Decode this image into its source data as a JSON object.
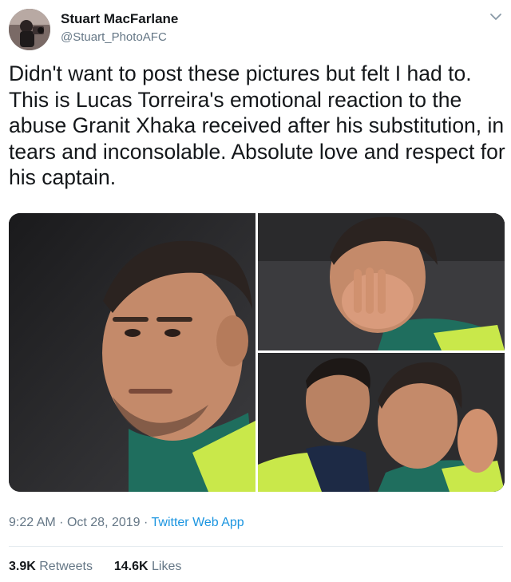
{
  "author": {
    "display_name": "Stuart MacFarlane",
    "handle": "@Stuart_PhotoAFC",
    "avatar_icon": "profile-photo"
  },
  "menu_icon": "chevron-down-icon",
  "tweet": {
    "text": "Didn't want to post these pictures but felt I had to. This is Lucas Torreira's emotional reaction to the abuse Granit Xhaka received after his substitution, in tears and inconsolable. Absolute love and respect for his captain."
  },
  "meta": {
    "time": "9:22 AM",
    "separator": "·",
    "date": "Oct 28, 2019",
    "source": "Twitter Web App"
  },
  "stats": {
    "retweets_count": "3.9K",
    "retweets_label": "Retweets",
    "likes_count": "14.6K",
    "likes_label": "Likes"
  },
  "colors": {
    "text": "#14171a",
    "secondary": "#657786",
    "link": "#1b95e0",
    "divider": "#e6ecf0"
  }
}
